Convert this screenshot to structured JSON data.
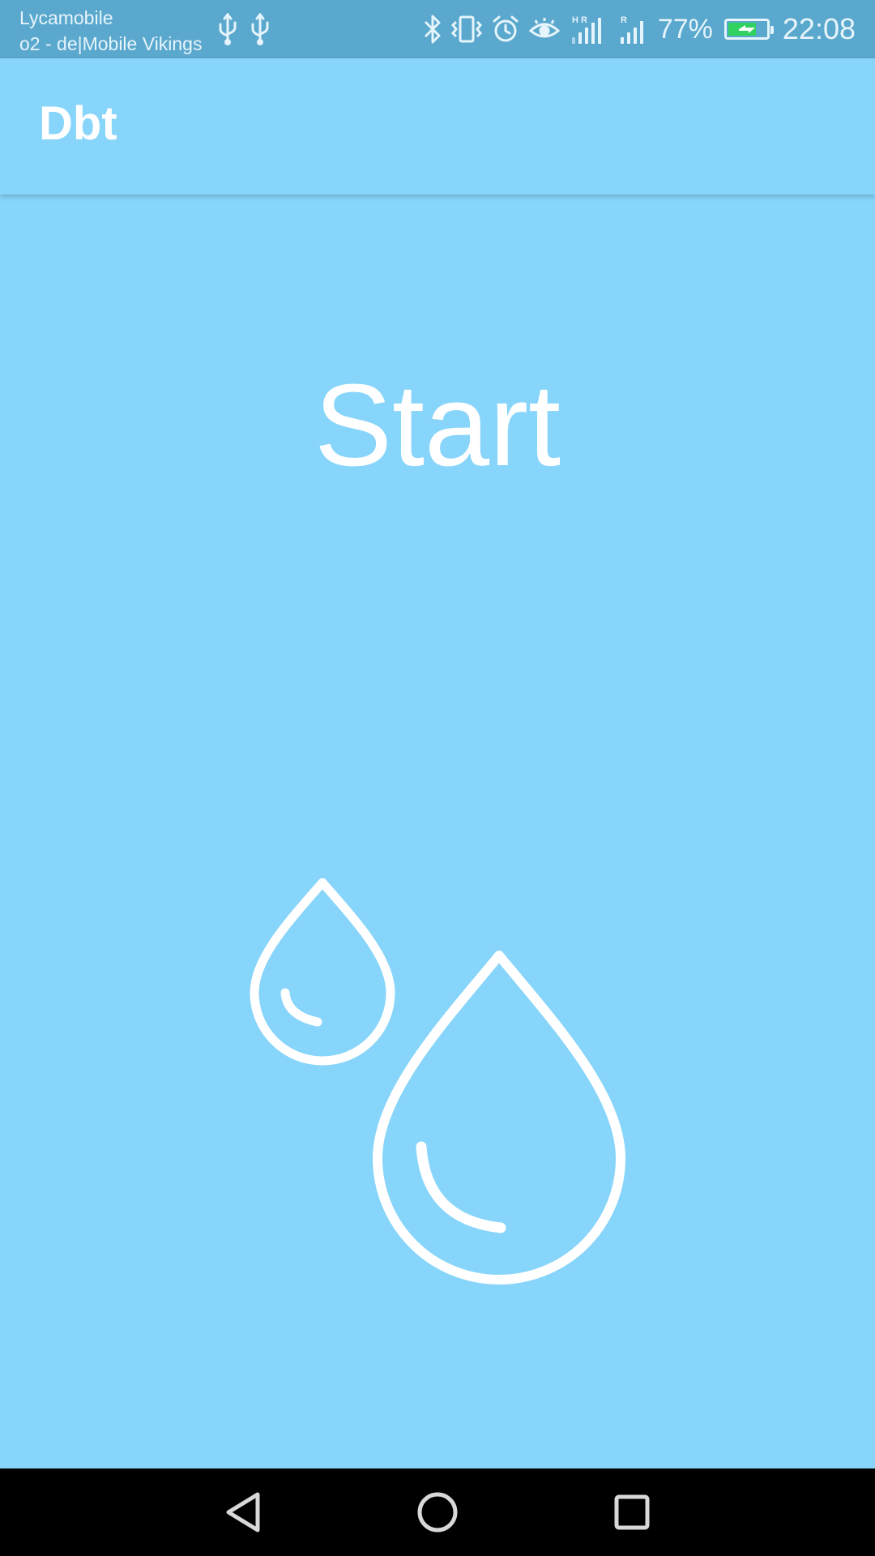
{
  "status_bar": {
    "carrier_1": "Lycamobile",
    "carrier_2": "o2 - de|Mobile Vikings",
    "battery_percent": "77%",
    "battery_level": 0.77,
    "time": "22:08",
    "icons": [
      "usb-icon",
      "usb-icon",
      "bluetooth-icon",
      "vibrate-icon",
      "alarm-icon",
      "eye-icon",
      "signal-icon",
      "signal-icon",
      "battery-charging-icon"
    ],
    "battery_fill_color": "#2fd25f"
  },
  "app_bar": {
    "title": "Dbt",
    "background_color": "#87d5fa"
  },
  "main": {
    "start_label": "Start",
    "illustration": "water-drops-icon",
    "background_color": "#87d5fa"
  },
  "nav_bar": {
    "buttons": [
      "back-icon",
      "home-icon",
      "recents-icon"
    ]
  }
}
